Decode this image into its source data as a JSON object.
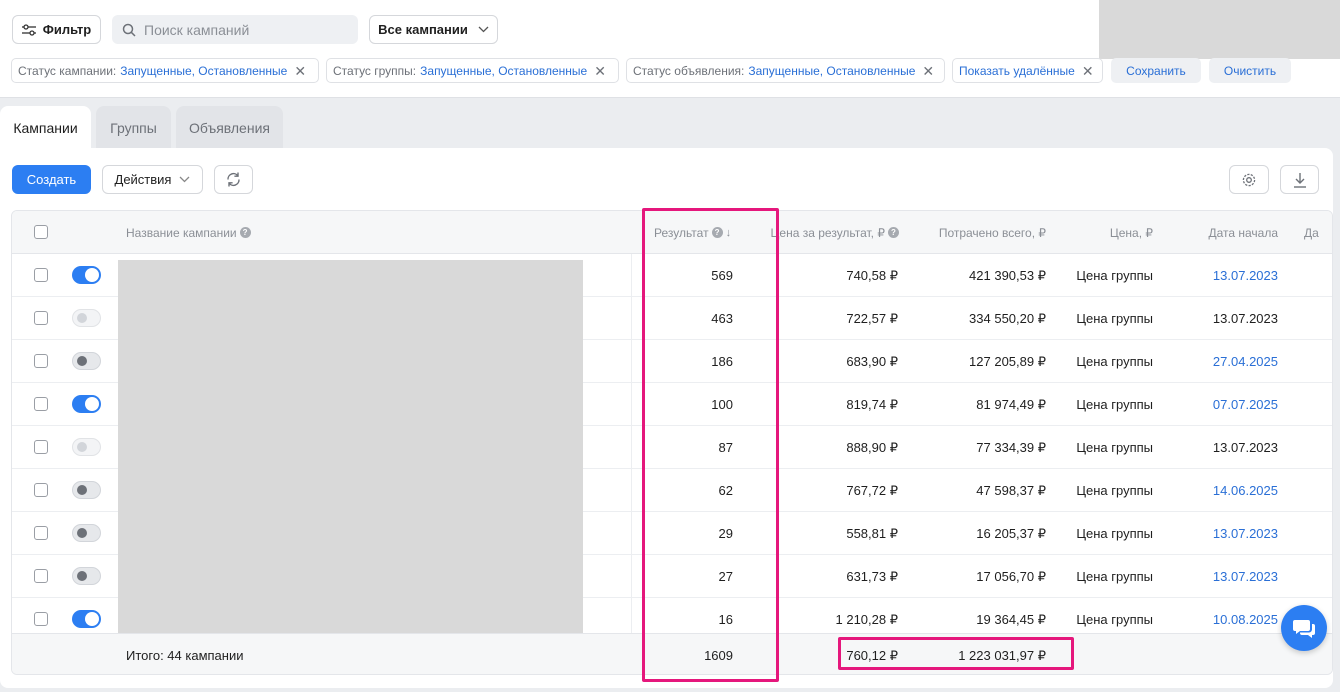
{
  "toolbar": {
    "filter_label": "Фильтр",
    "search_placeholder": "Поиск кампаний",
    "scope_label": "Все кампании"
  },
  "chips": [
    {
      "label": "Статус кампании:",
      "value": "Запущенные, Остановленные"
    },
    {
      "label": "Статус группы:",
      "value": "Запущенные, Остановленные"
    },
    {
      "label": "Статус объявления:",
      "value": "Запущенные, Остановленные"
    },
    {
      "label": "",
      "value": "Показать удалённые"
    }
  ],
  "chip_actions": {
    "save": "Сохранить",
    "clear": "Очистить"
  },
  "tabs": [
    {
      "label": "Кампании",
      "active": true
    },
    {
      "label": "Группы",
      "active": false
    },
    {
      "label": "Объявления",
      "active": false
    }
  ],
  "actions": {
    "create": "Создать",
    "actions": "Действия"
  },
  "table": {
    "columns": {
      "name": "Название кампании",
      "result": "Результат",
      "price_per_result": "Цена за результат, ₽",
      "spent_total": "Потрачено всего, ₽",
      "price": "Цена, ₽",
      "start_date": "Дата начала",
      "end_date_partial": "Да"
    },
    "rows": [
      {
        "toggle": "on",
        "result": "569",
        "price_per_result": "740,58 ₽",
        "spent": "421 390,53 ₽",
        "price": "Цена группы",
        "start_date": "13.07.2023",
        "date_link": true
      },
      {
        "toggle": "disabled",
        "result": "463",
        "price_per_result": "722,57 ₽",
        "spent": "334 550,20 ₽",
        "price": "Цена группы",
        "start_date": "13.07.2023",
        "date_link": false
      },
      {
        "toggle": "off",
        "result": "186",
        "price_per_result": "683,90 ₽",
        "spent": "127 205,89 ₽",
        "price": "Цена группы",
        "start_date": "27.04.2025",
        "date_link": true
      },
      {
        "toggle": "on",
        "result": "100",
        "price_per_result": "819,74 ₽",
        "spent": "81 974,49 ₽",
        "price": "Цена группы",
        "start_date": "07.07.2025",
        "date_link": true
      },
      {
        "toggle": "disabled",
        "result": "87",
        "price_per_result": "888,90 ₽",
        "spent": "77 334,39 ₽",
        "price": "Цена группы",
        "start_date": "13.07.2023",
        "date_link": false
      },
      {
        "toggle": "off",
        "result": "62",
        "price_per_result": "767,72 ₽",
        "spent": "47 598,37 ₽",
        "price": "Цена группы",
        "start_date": "14.06.2025",
        "date_link": true
      },
      {
        "toggle": "off",
        "result": "29",
        "price_per_result": "558,81 ₽",
        "spent": "16 205,37 ₽",
        "price": "Цена группы",
        "start_date": "13.07.2023",
        "date_link": true
      },
      {
        "toggle": "off",
        "result": "27",
        "price_per_result": "631,73 ₽",
        "spent": "17 056,70 ₽",
        "price": "Цена группы",
        "start_date": "13.07.2023",
        "date_link": true
      },
      {
        "toggle": "on",
        "result": "16",
        "price_per_result": "1 210,28 ₽",
        "spent": "19 364,45 ₽",
        "price": "Цена группы",
        "start_date": "10.08.2025",
        "date_link": true
      }
    ],
    "footer": {
      "total_label": "Итого: 44 кампании",
      "result": "1609",
      "price_per_result": "760,12 ₽",
      "spent": "1 223 031,97 ₽"
    }
  },
  "colors": {
    "accent": "#2c7ef2",
    "link": "#2a6fd6",
    "highlight": "#e5177c"
  }
}
